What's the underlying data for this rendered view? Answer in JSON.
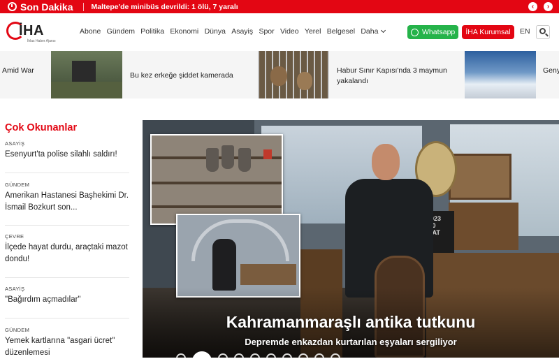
{
  "breaking": {
    "title": "Son Dakika",
    "text": "Maltepe'de minibüs devrildi: 1 ölü, 7 yaralı",
    "prev_icon": "‹",
    "next_icon": "›"
  },
  "header": {
    "logo_text": "İHA",
    "logo_sub": "İhlas Haber Ajansı",
    "nav": [
      "Abone",
      "Gündem",
      "Politika",
      "Ekonomi",
      "Dünya",
      "Asayiş",
      "Spor",
      "Video",
      "Yerel",
      "Belgesel",
      "Daha"
    ],
    "whatsapp": "Whatsapp",
    "kurumsal": "İHA Kurumsal",
    "lang": "EN",
    "colors": {
      "brand_red": "#e30613",
      "whatsapp_green": "#25b34a"
    }
  },
  "strip": [
    {
      "text": "Amid War"
    },
    {
      "text": "Bu kez erkeğe şiddet kamerada"
    },
    {
      "text": "Habur Sınır Kapısı'nda 3 maymun yakalandı"
    },
    {
      "text": "Geny manz"
    }
  ],
  "sidebar": {
    "title": "Çok Okunanlar",
    "items": [
      {
        "category": "ASAYİŞ",
        "headline": "Esenyurt'ta polise silahlı saldırı!"
      },
      {
        "category": "GÜNDEM",
        "headline": "Amerikan Hastanesi Başhekimi Dr. İsmail Bozkurt son..."
      },
      {
        "category": "ÇEVRE",
        "headline": "İlçede hayat durdu, araçtaki mazot dondu!"
      },
      {
        "category": "ASAYİŞ",
        "headline": "\"Bağırdım açmadılar\""
      },
      {
        "category": "GÜNDEM",
        "headline": "Yemek kartlarına \"asgari ücret\" düzenlemesi"
      }
    ]
  },
  "hero": {
    "headline": "Kahramanmaraşlı antika tutkunu",
    "subline": "Depremde enkazdan kurtarılan eşyaları sergiliyor",
    "sign_text": "2023\n0\nBAT",
    "slide_count": 10,
    "active_slide": 2
  }
}
